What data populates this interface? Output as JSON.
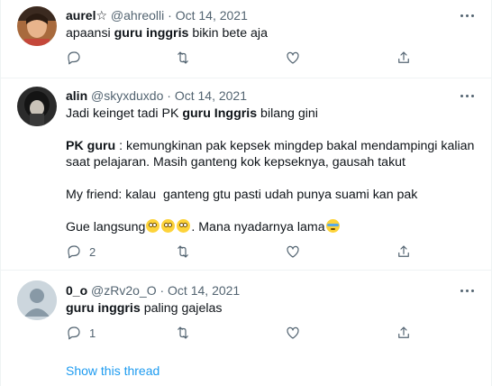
{
  "tweets": [
    {
      "name": "aurel☆",
      "handle": "@ahreolli",
      "date": "Oct 14, 2021",
      "text_segments": [
        {
          "text": "apaansi ",
          "bold": false
        },
        {
          "text": "guru inggris",
          "bold": true
        },
        {
          "text": " bikin bete aja",
          "bold": false
        }
      ],
      "reply_count": "",
      "avatar": "person-photo"
    },
    {
      "name": "alin",
      "handle": "@skyxduxdo",
      "date": "Oct 14, 2021",
      "line1_pre": "Jadi keinget tadi PK ",
      "line1_bold": "guru Inggris",
      "line1_post": " bilang gini",
      "para2_bold": "PK guru",
      "para2_rest": " : kemungkinan pak kepsek mingdep bakal mendampingi kalian saat pelajaran. Masih ganteng kok kepseknya, gausah takut",
      "para3": "My friend: kalau  ganteng gtu pasti udah punya suami kan pak",
      "para4_pre": "Gue langsung",
      "para4_mid": ". Mana nyadarnya lama",
      "emoji_flushed": "flushed-face-emoji",
      "emoji_crying": "loudly-crying-face-emoji",
      "reply_count": "2",
      "avatar": "person-photo-dark"
    },
    {
      "name": "0_o",
      "handle": "@zRv2o_O",
      "date": "Oct 14, 2021",
      "text_bold": "guru inggris",
      "text_rest": " paling gajelas",
      "reply_count": "1",
      "avatar": "default-profile"
    }
  ],
  "show_thread": "Show this thread",
  "separator": " · ",
  "icons": {
    "reply": "reply-icon",
    "retweet": "retweet-icon",
    "like": "heart-icon",
    "share": "share-icon",
    "more": "more-icon"
  },
  "colors": {
    "link": "#1d9bf0",
    "secondary": "#536471",
    "border": "#eff3f4"
  }
}
